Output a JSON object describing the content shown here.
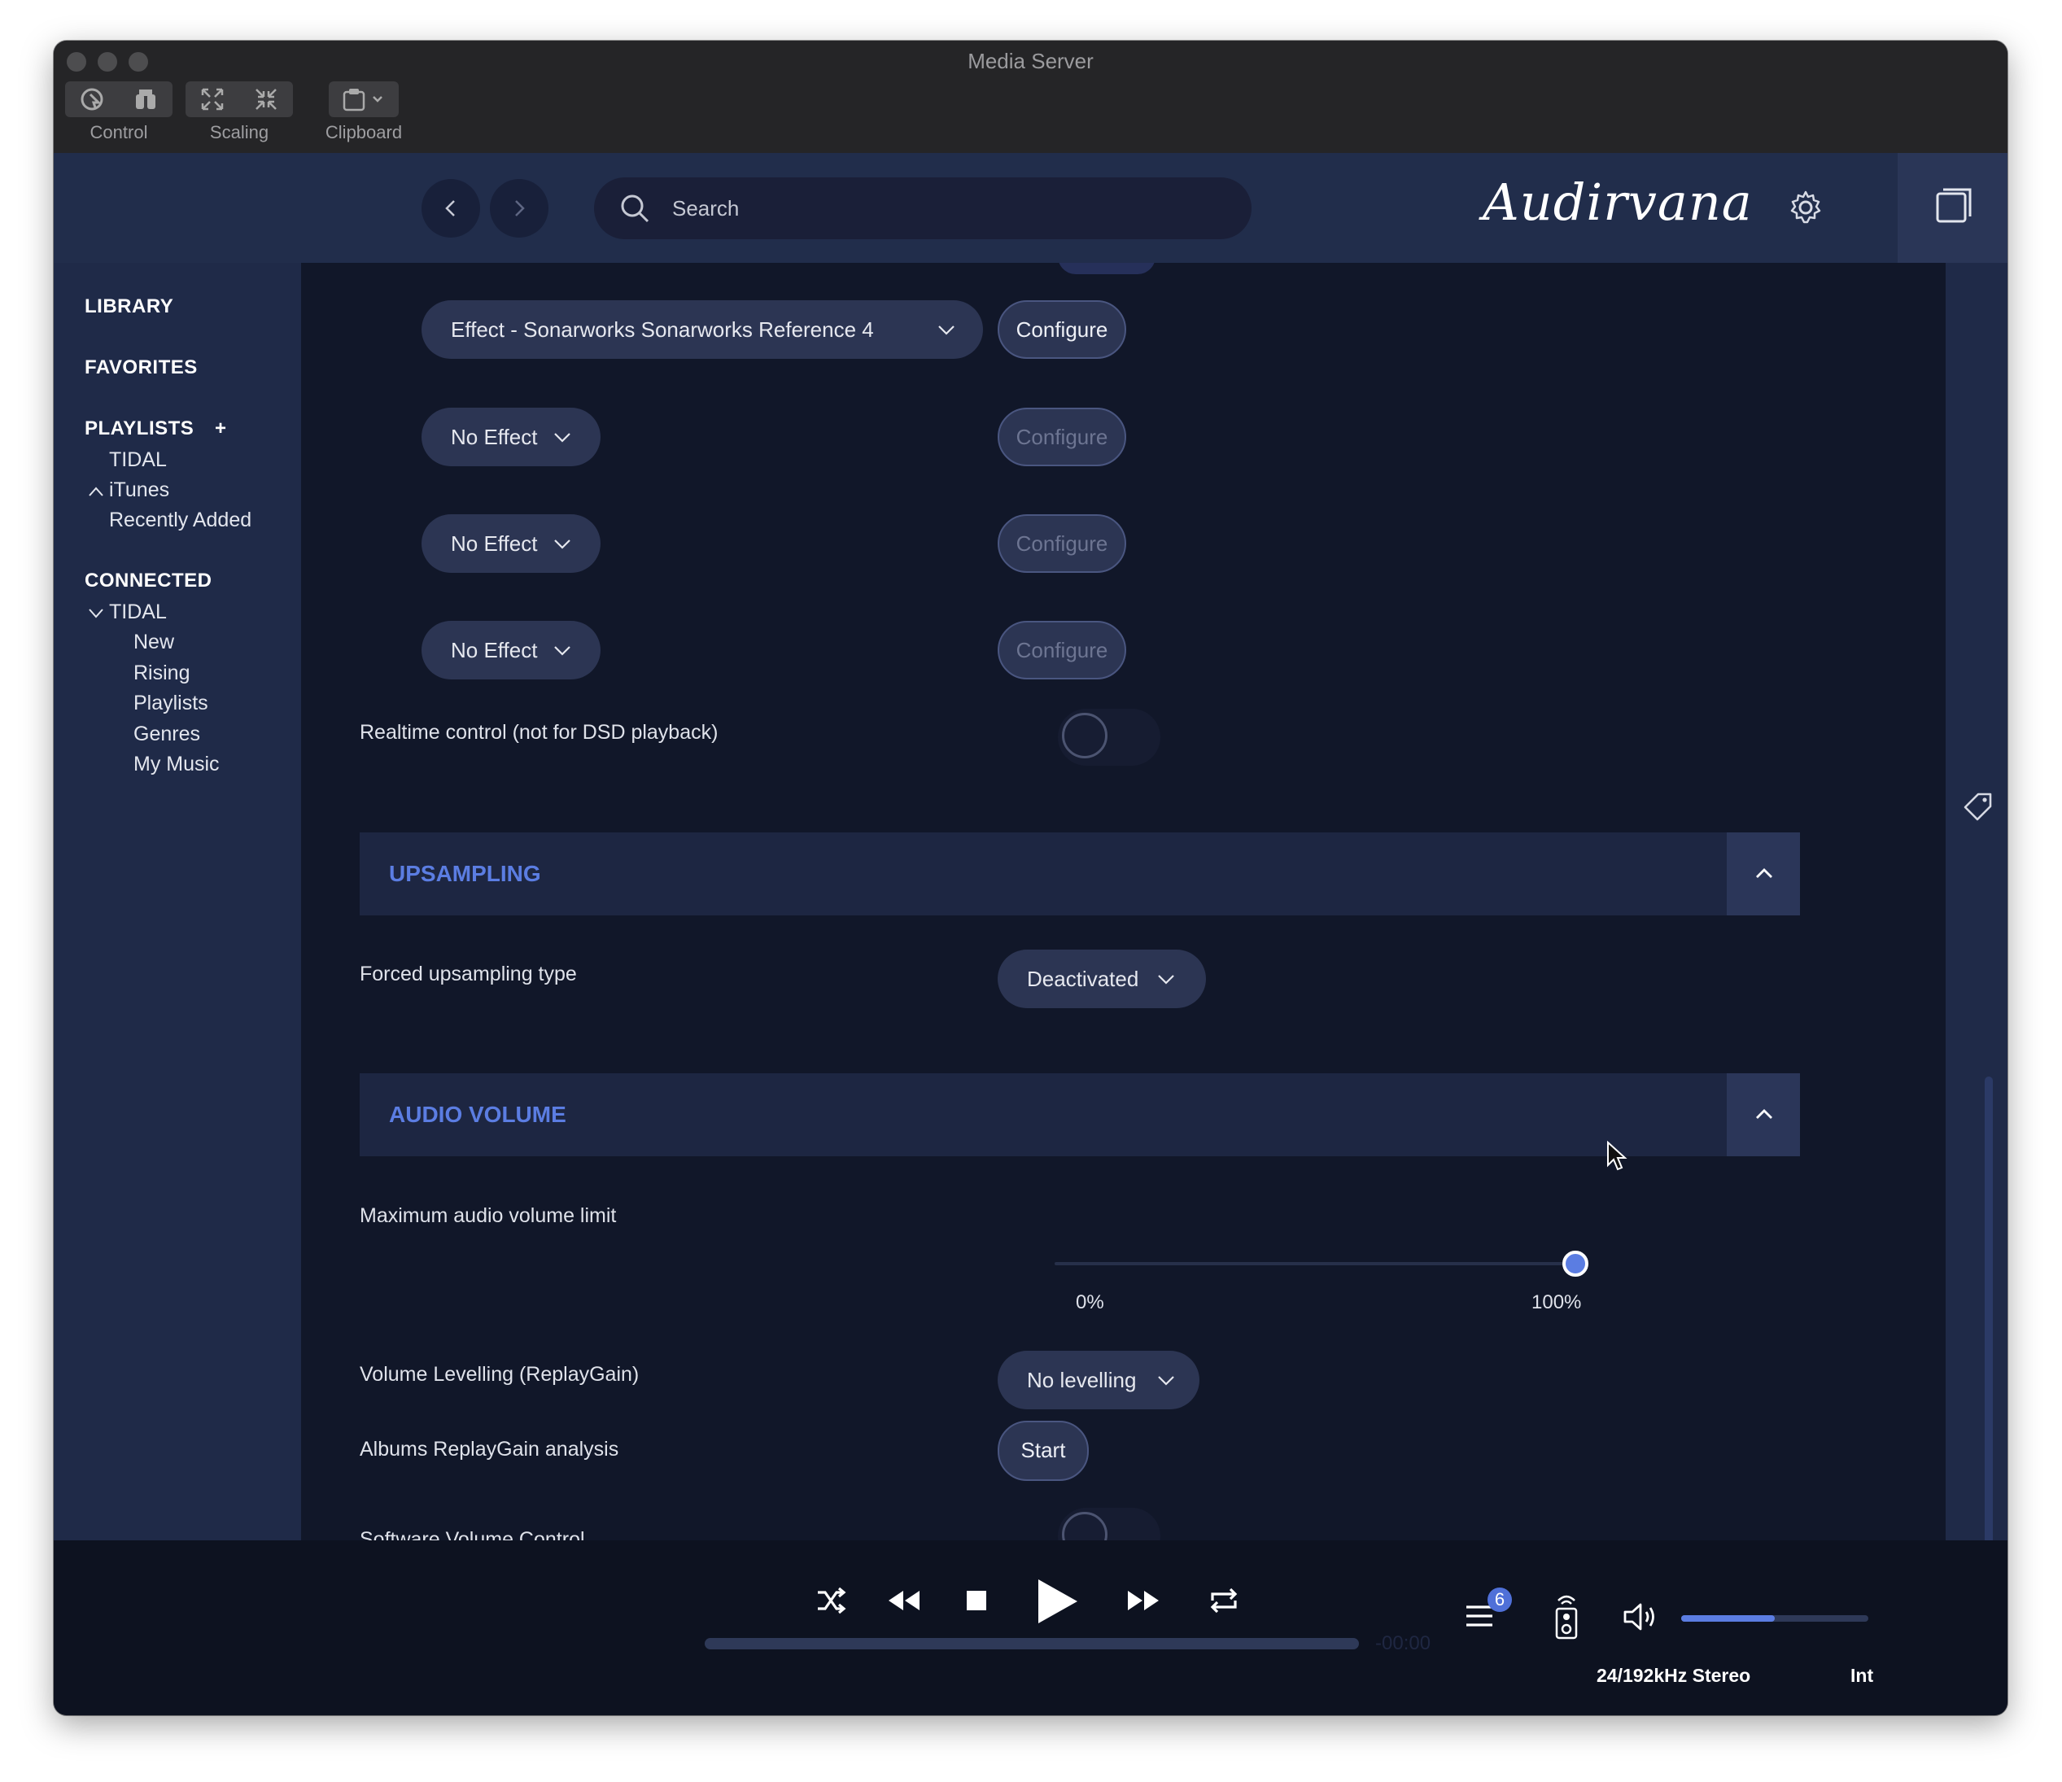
{
  "window": {
    "title": "Media Server"
  },
  "toolbar": {
    "control_label": "Control",
    "scaling_label": "Scaling",
    "clipboard_label": "Clipboard"
  },
  "header": {
    "search_placeholder": "Search",
    "logo_text": "Audirvana"
  },
  "sidebar": {
    "library": "LIBRARY",
    "favorites": "FAVORITES",
    "playlists": "PLAYLISTS",
    "playlists_add": "+",
    "playlist_items": [
      "TIDAL",
      "iTunes",
      "Recently Added"
    ],
    "connected": "CONNECTED",
    "connected_service": "TIDAL",
    "connected_items": [
      "New",
      "Rising",
      "Playlists",
      "Genres",
      "My Music"
    ]
  },
  "effects": {
    "slots": [
      {
        "value": "Effect - Sonarworks Sonarworks Reference 4",
        "configure": "Configure",
        "configure_enabled": true
      },
      {
        "value": "No Effect",
        "configure": "Configure",
        "configure_enabled": false
      },
      {
        "value": "No Effect",
        "configure": "Configure",
        "configure_enabled": false
      },
      {
        "value": "No Effect",
        "configure": "Configure",
        "configure_enabled": false
      }
    ],
    "realtime_label": "Realtime control (not for DSD playback)",
    "realtime_on": false
  },
  "upsampling": {
    "title": "UPSAMPLING",
    "forced_label": "Forced upsampling type",
    "forced_value": "Deactivated"
  },
  "audio_volume": {
    "title": "AUDIO VOLUME",
    "max_label": "Maximum audio volume limit",
    "max_value_fraction": 1.0,
    "min_tick": "0%",
    "max_tick": "100%",
    "levelling_label": "Volume Levelling (ReplayGain)",
    "levelling_value": "No levelling",
    "replaygain_label": "Albums ReplayGain analysis",
    "replaygain_button": "Start",
    "software_label": "Software Volume Control",
    "software_on": false
  },
  "player": {
    "time_remaining": "-00:00",
    "queue_count": "6",
    "volume_fraction": 0.5,
    "format": "24/192kHz Stereo",
    "output": "Int"
  },
  "colors": {
    "accent": "#5b7de2",
    "sidebar_bg": "#1f2a48",
    "content_bg": "#111729"
  }
}
